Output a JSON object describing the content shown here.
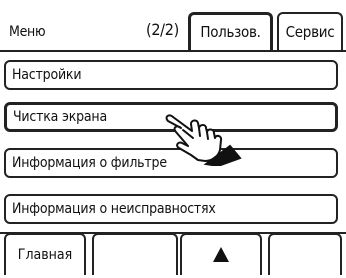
{
  "header": {
    "title": "Меню",
    "page": "(2/2)",
    "tabs": {
      "user": "Пользов.",
      "service": "Сервис"
    }
  },
  "menu": {
    "items": [
      "Настройки",
      "Чистка экрана",
      "Информация о фильтре",
      "Информация о неисправностях"
    ]
  },
  "footer": {
    "home": "Главная",
    "up_icon": "up-arrow-icon"
  },
  "overlay": {
    "icon": "pointing-hand-icon"
  }
}
